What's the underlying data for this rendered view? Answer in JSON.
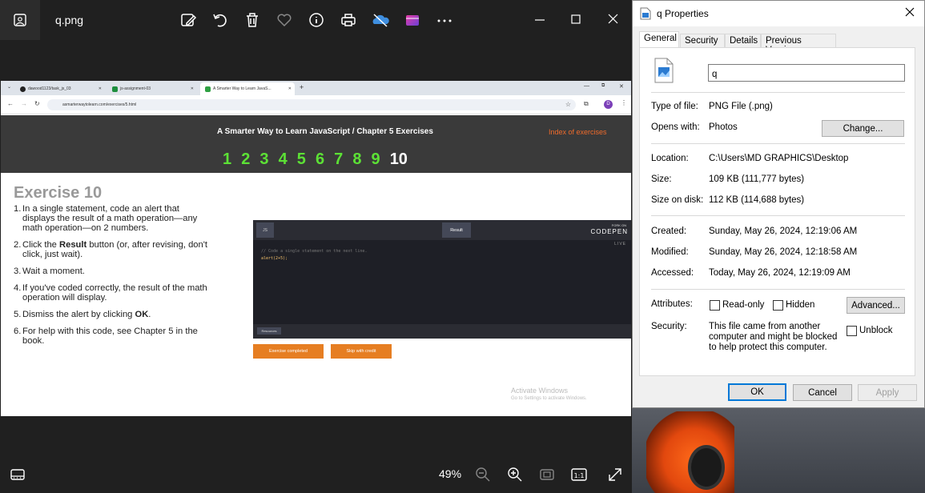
{
  "viewer": {
    "title": "q.png",
    "zoom": "49%",
    "toolbar_icons": [
      "edit-image-icon",
      "rotate-icon",
      "delete-icon",
      "favorite-icon",
      "info-icon",
      "print-icon",
      "onedrive-icon",
      "clipchamp-icon",
      "more-icon"
    ],
    "window_controls": [
      "minimize-icon",
      "maximize-icon",
      "close-icon"
    ],
    "bottom_icons": [
      "filmstrip-icon",
      "zoom-out-icon",
      "zoom-in-icon",
      "fit-icon",
      "actual-size-icon",
      "fullscreen-icon"
    ],
    "actual_size_label": "1:1"
  },
  "photo": {
    "tabs": [
      {
        "label": "dawood1123/task_js_03",
        "favicon_color": "#222222"
      },
      {
        "label": "js-assignment-03",
        "favicon_color": "#1e8e3e"
      },
      {
        "label": "A Smarter Way to Learn JavaS...",
        "favicon_color": "#2ea043"
      }
    ],
    "url": "asmarterwaytolearn.com/exercises/5.html",
    "profile_letter": "D",
    "site": {
      "heading": "A Smarter Way to Learn JavaScript / Chapter 5 Exercises",
      "index_link": "Index of exercises",
      "exercise_numbers": [
        "1",
        "2",
        "3",
        "4",
        "5",
        "6",
        "7",
        "8",
        "9",
        "10"
      ],
      "current_exercise": "10",
      "exercise_title": "Exercise 10",
      "steps": [
        {
          "n": "1.",
          "text": "In a single statement, code an alert that displays the result of a math operation—any math operation—on 2 numbers."
        },
        {
          "n": "2.",
          "pre": "Click the ",
          "bold": "Result",
          "post": " button (or, after revising, don't click, just wait)."
        },
        {
          "n": "3.",
          "text": "Wait a moment."
        },
        {
          "n": "4.",
          "text": "If you've coded correctly, the result of the math operation will display."
        },
        {
          "n": "5.",
          "pre": "Dismiss the alert by clicking ",
          "bold": "OK",
          "post": "."
        },
        {
          "n": "6.",
          "text": "For help with this code, see Chapter 5 in the book."
        }
      ],
      "codepen": {
        "js_tab": "JS",
        "result_button": "Result",
        "fork_on": "FORK ON",
        "brand": "CODEPEN",
        "live": "LIVE",
        "comment": "// Code a single statement on the next line.",
        "code": "alert(2+5);",
        "resources": "Resources"
      },
      "buttons": {
        "completed": "Exercise completed",
        "skip": "Skip with credit",
        "color": "#e67e22"
      },
      "activate": {
        "title": "Activate Windows",
        "sub": "Go to Settings to activate Windows."
      }
    }
  },
  "dialog": {
    "title": "q Properties",
    "tabs": [
      "General",
      "Security",
      "Details",
      "Previous Versions"
    ],
    "active_tab": "General",
    "file_name": "q",
    "type_label": "Type of file:",
    "type_value": "PNG File (.png)",
    "opens_label": "Opens with:",
    "opens_value": "Photos",
    "change_button": "Change...",
    "location_label": "Location:",
    "location_value": "C:\\Users\\MD GRAPHICS\\Desktop",
    "size_label": "Size:",
    "size_value": "109 KB (111,777 bytes)",
    "disk_label": "Size on disk:",
    "disk_value": "112 KB (114,688 bytes)",
    "created_label": "Created:",
    "created_value": "Sunday, May 26, 2024, 12:19:06 AM",
    "modified_label": "Modified:",
    "modified_value": "Sunday, May 26, 2024, 12:18:58 AM",
    "accessed_label": "Accessed:",
    "accessed_value": "Today, May 26, 2024, 12:19:09 AM",
    "attributes_label": "Attributes:",
    "readonly_label": "Read-only",
    "readonly_checked": false,
    "hidden_label": "Hidden",
    "hidden_checked": false,
    "advanced_button": "Advanced...",
    "security_label": "Security:",
    "security_text": "This file came from another computer and might be blocked to help protect this computer.",
    "unblock_label": "Unblock",
    "unblock_checked": false,
    "ok": "OK",
    "cancel": "Cancel",
    "apply": "Apply"
  }
}
